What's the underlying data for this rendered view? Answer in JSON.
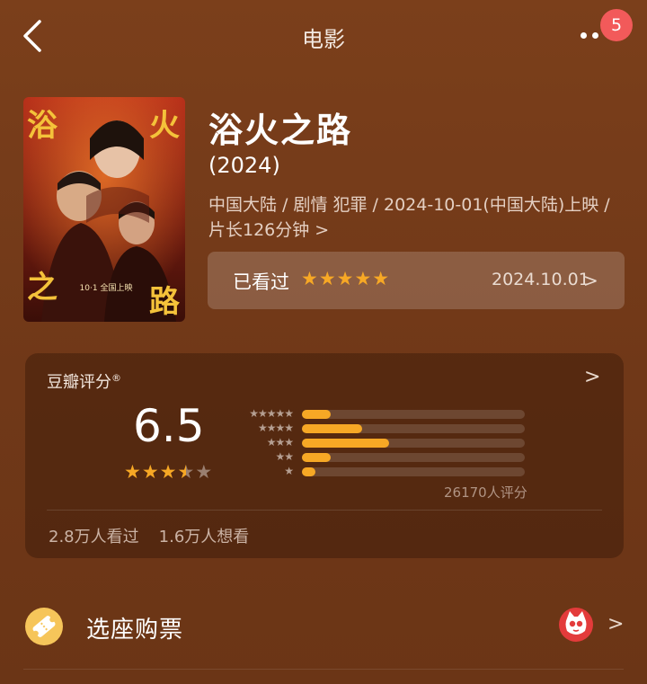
{
  "header": {
    "title": "电影",
    "notification_count": "5"
  },
  "movie": {
    "title": "浴火之路",
    "year": "(2024)",
    "meta_line1": "中国大陆 / 剧情 犯罪 / 2024-10-01(中国大陆)上映 /",
    "meta_line2": "片长126分钟",
    "meta_chevron": ">",
    "poster_texts": {
      "char_top_left": "浴",
      "char_top_right": "火",
      "char_bottom_left": "之",
      "char_bottom_right": "路",
      "release_tag": "10·1 全国上映"
    }
  },
  "watched": {
    "label": "已看过",
    "stars": "★★★★★",
    "stars_value": 5,
    "date": "2024.10.01",
    "chevron": ">"
  },
  "rating": {
    "label": "豆瓣评分",
    "mark": "®",
    "score": "6.5",
    "stars_on": "★★★",
    "stars_half": "★",
    "stars_off": "★",
    "stars_value": 3.5,
    "distribution": [
      {
        "stars": "★★★★★",
        "fraction": 0.13
      },
      {
        "stars": "★★★★",
        "fraction": 0.27
      },
      {
        "stars": "★★★",
        "fraction": 0.39
      },
      {
        "stars": "★★",
        "fraction": 0.13
      },
      {
        "stars": "★",
        "fraction": 0.06
      }
    ],
    "count_text": "26170人评分",
    "watched_text": "2.8万人看过",
    "want_text": "1.6万人想看",
    "chevron": ">"
  },
  "tickets": {
    "label": "选座购票",
    "chevron": ">"
  },
  "colors": {
    "background": "#7b3f1b",
    "accent_star": "#f7a825",
    "badge": "#f25a5a",
    "ticket_icon": "#f6c55a"
  }
}
